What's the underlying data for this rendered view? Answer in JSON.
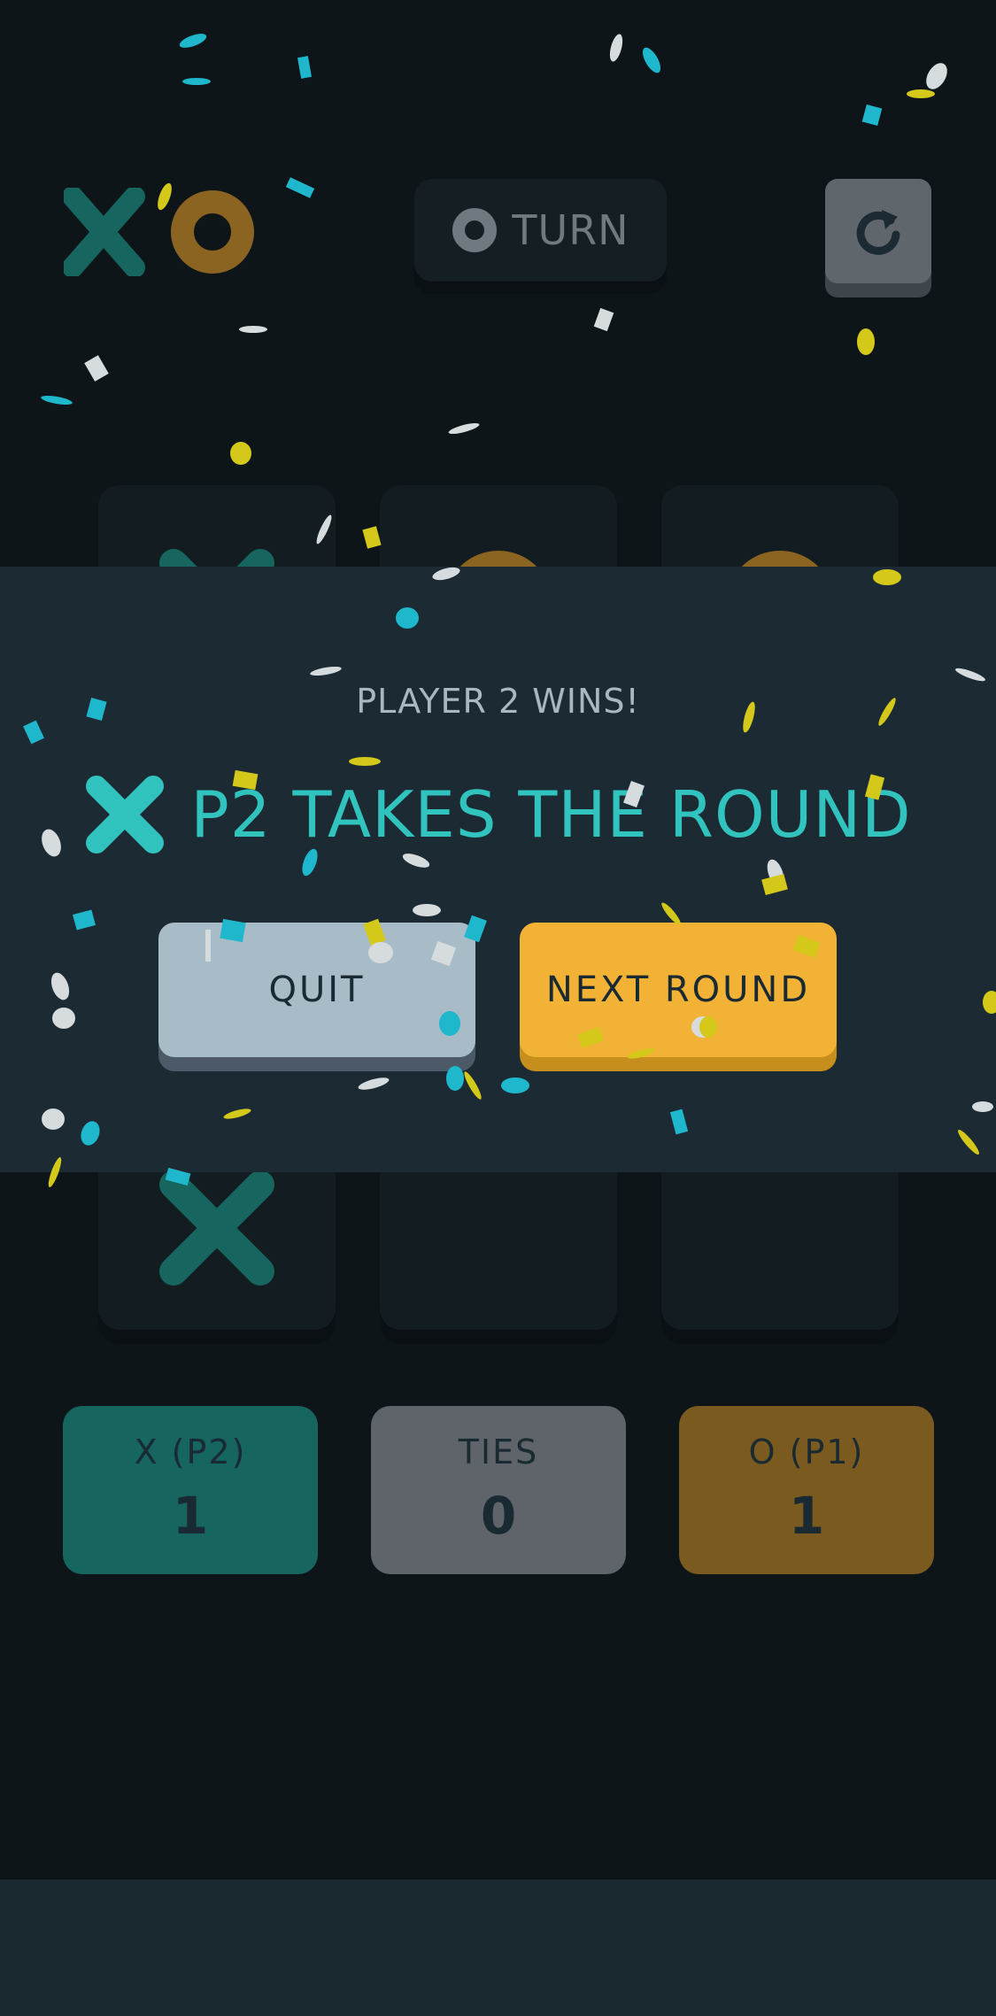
{
  "header": {
    "logo": {
      "x_icon": "x-mark-icon",
      "o_icon": "o-mark-icon"
    },
    "turn_label": "TURN",
    "turn_icon": "o-mark-icon",
    "restart_icon": "restart-icon"
  },
  "board": {
    "cells": [
      "X",
      "O",
      "O",
      "",
      "",
      "",
      "X",
      "",
      ""
    ]
  },
  "result": {
    "subtitle": "PLAYER 2 WINS!",
    "title": "P2 TAKES THE ROUND",
    "winner_icon": "x-mark-icon",
    "quit_label": "QUIT",
    "next_label": "NEXT ROUND"
  },
  "scores": {
    "x_label": "X (P2)",
    "x_value": "1",
    "ties_label": "TIES",
    "ties_value": "0",
    "o_label": "O (P1)",
    "o_value": "1"
  },
  "colors": {
    "background": "#0d1519",
    "x_color": "#31c3bd",
    "o_color": "#f2b236",
    "overlay": "#1c2b33",
    "quit_button": "#a8bcc8",
    "next_button": "#f2b236"
  }
}
